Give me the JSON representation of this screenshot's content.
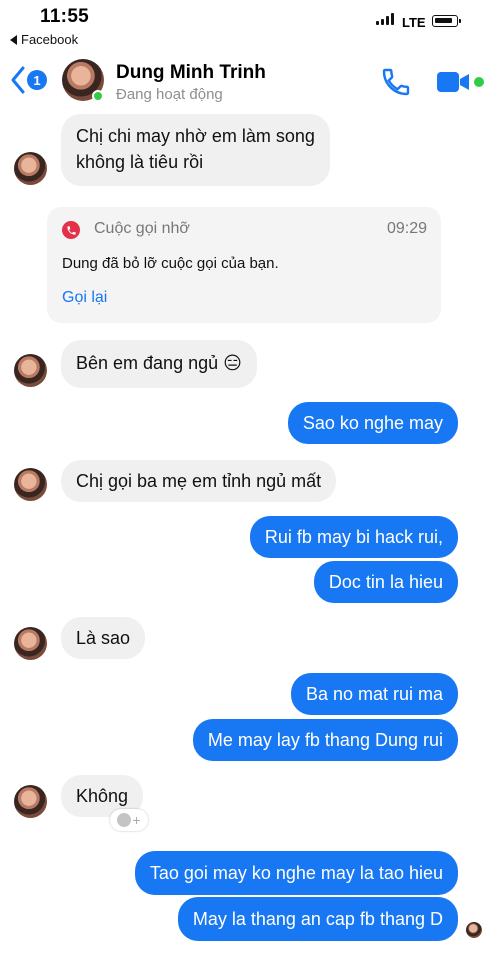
{
  "status_bar": {
    "time": "11:55",
    "back_app_label": "Facebook",
    "network": "LTE"
  },
  "header": {
    "unread_count": "1",
    "contact_name": "Dung Minh Trinh",
    "contact_status": "Đang hoạt động",
    "accent_color": "#1877f2",
    "active_color": "#31cc46"
  },
  "messages": {
    "m1": "Chị chi may nhờ em làm song",
    "m1_line2": "không là tiêu rồi",
    "missed_call": {
      "label": "Cuộc gọi nhỡ",
      "time": "09:29",
      "text": "Dung đã bỏ lỡ cuộc gọi của bạn.",
      "callback": "Gọi lại"
    },
    "m2": "Bên em đang ngủ 😑",
    "m3": "Sao ko nghe may",
    "m4": "Chị gọi ba mẹ em tỉnh ngủ mất",
    "m5": "Rui fb may bi hack rui,",
    "m6": "Doc tin la hieu",
    "m7": "Là sao",
    "m8": "Ba no mat rui ma",
    "m9": "Me may lay fb thang Dung rui",
    "m10": "Không",
    "m11": "Tao goi may ko nghe may la tao hieu",
    "m12": "May la thang an cap fb thang D"
  }
}
